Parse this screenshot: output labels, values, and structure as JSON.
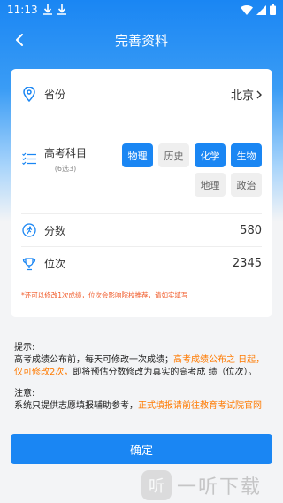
{
  "status": {
    "time": "11:13"
  },
  "nav": {
    "title": "完善资料"
  },
  "province": {
    "label": "省份",
    "value": "北京"
  },
  "subjects": {
    "label": "高考科目",
    "hint": "(6选3)",
    "items": [
      {
        "name": "物理",
        "selected": true
      },
      {
        "name": "历史",
        "selected": false
      },
      {
        "name": "化学",
        "selected": true
      },
      {
        "name": "生物",
        "selected": true
      },
      {
        "name": "地理",
        "selected": false
      },
      {
        "name": "政治",
        "selected": false
      }
    ]
  },
  "score": {
    "label": "分数",
    "value": "580"
  },
  "rank": {
    "label": "位次",
    "value": "2345"
  },
  "card_note": "*还可以修改1次成绩，位次会影响院校推荐，请如实填写",
  "info": {
    "tip_title": "提示:",
    "tip_1": "高考成绩公布前，每天可修改一次成绩；",
    "tip_2": "高考成绩公布之 日起，仅可修改2次，",
    "tip_3": "即将预估分数修改为真实的高考成 绩（位次）。",
    "notice_title": "注意:",
    "notice_1": "系统只提供志愿填报辅助参考，",
    "notice_2": "正式填报请前往教育考试院官网"
  },
  "confirm_label": "确定",
  "watermark": {
    "logo_char": "听",
    "text": "一听下载"
  },
  "colors": {
    "accent": "#1a86f3",
    "highlight": "#ff7a00",
    "warning": "#f05a28"
  }
}
